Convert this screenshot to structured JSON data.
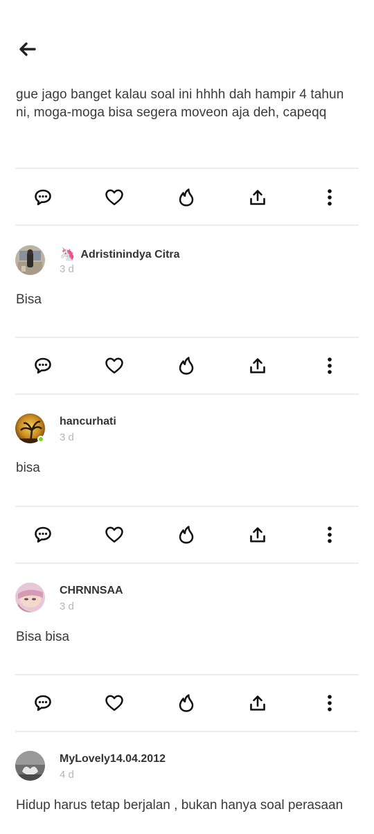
{
  "header": {
    "back_icon": "arrow-left-icon"
  },
  "post": {
    "text": "gue jago banget kalau soal ini hhhh dah hampir 4 tahun ni, moga-moga bisa segera moveon aja deh, capeqq"
  },
  "actions": {
    "icons": [
      "comment-icon",
      "heart-icon",
      "fire-icon",
      "share-icon",
      "more-icon"
    ]
  },
  "comments": [
    {
      "badge": "🦄",
      "username": "Adristinindya Citra",
      "time": "3 d",
      "text": "Bisa",
      "online": false
    },
    {
      "badge": "",
      "username": "hancurhati",
      "time": "3 d",
      "text": "bisa",
      "online": true
    },
    {
      "badge": "",
      "username": "CHRNNSAA",
      "time": "3 d",
      "text": "Bisa bisa",
      "online": false
    },
    {
      "badge": "",
      "username": "MyLovely14.04.2012",
      "time": "4 d",
      "text": "Hidup harus tetap berjalan , bukan hanya soal perasaan",
      "online": false
    }
  ],
  "colors": {
    "text": "#3a3a3a",
    "muted": "#b5b5b5",
    "divider": "#ececec",
    "online": "#7ed321"
  }
}
